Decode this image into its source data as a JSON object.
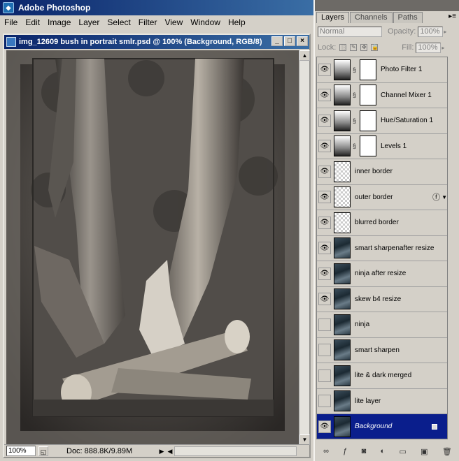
{
  "app": {
    "title": "Adobe Photoshop"
  },
  "menu": [
    "File",
    "Edit",
    "Image",
    "Layer",
    "Select",
    "Filter",
    "View",
    "Window",
    "Help"
  ],
  "document": {
    "title": "img_12609 bush in portrait smlr.psd @ 100% (Background, RGB/8)",
    "zoom": "100%",
    "doc_info": "Doc: 888.8K/9.89M"
  },
  "palette": {
    "tabs": [
      "Layers",
      "Channels",
      "Paths"
    ],
    "blend_mode": "Normal",
    "opacity_label": "Opacity:",
    "opacity_value": "100%",
    "lock_label": "Lock:",
    "fill_label": "Fill:",
    "fill_value": "100%",
    "layers": [
      {
        "name": "Photo Filter 1",
        "visible": true,
        "thumb": "adj",
        "mask": true
      },
      {
        "name": "Channel Mixer 1",
        "visible": true,
        "thumb": "adj",
        "mask": true
      },
      {
        "name": "Hue/Saturation 1",
        "visible": true,
        "thumb": "adj",
        "mask": true
      },
      {
        "name": "Levels 1",
        "visible": true,
        "thumb": "adj",
        "mask": true
      },
      {
        "name": "inner border",
        "visible": true,
        "thumb": "trans",
        "mask": false
      },
      {
        "name": "outer border",
        "visible": true,
        "thumb": "trans",
        "mask": false,
        "fx": true
      },
      {
        "name": "blurred border",
        "visible": true,
        "thumb": "trans",
        "mask": false
      },
      {
        "name": "smart sharpenafter resize",
        "visible": true,
        "thumb": "photo",
        "mask": false
      },
      {
        "name": "ninja after resize",
        "visible": true,
        "thumb": "photo",
        "mask": false
      },
      {
        "name": "skew b4 resize",
        "visible": true,
        "thumb": "photo",
        "mask": false
      },
      {
        "name": "ninja",
        "visible": false,
        "thumb": "photo",
        "mask": false
      },
      {
        "name": "smart sharpen",
        "visible": false,
        "thumb": "photo",
        "mask": false
      },
      {
        "name": "lite & dark merged",
        "visible": false,
        "thumb": "photo",
        "mask": false
      },
      {
        "name": "lite layer",
        "visible": false,
        "thumb": "photo",
        "mask": false
      },
      {
        "name": "Background",
        "visible": true,
        "thumb": "photo",
        "mask": false,
        "selected": true,
        "locked": true
      }
    ]
  }
}
